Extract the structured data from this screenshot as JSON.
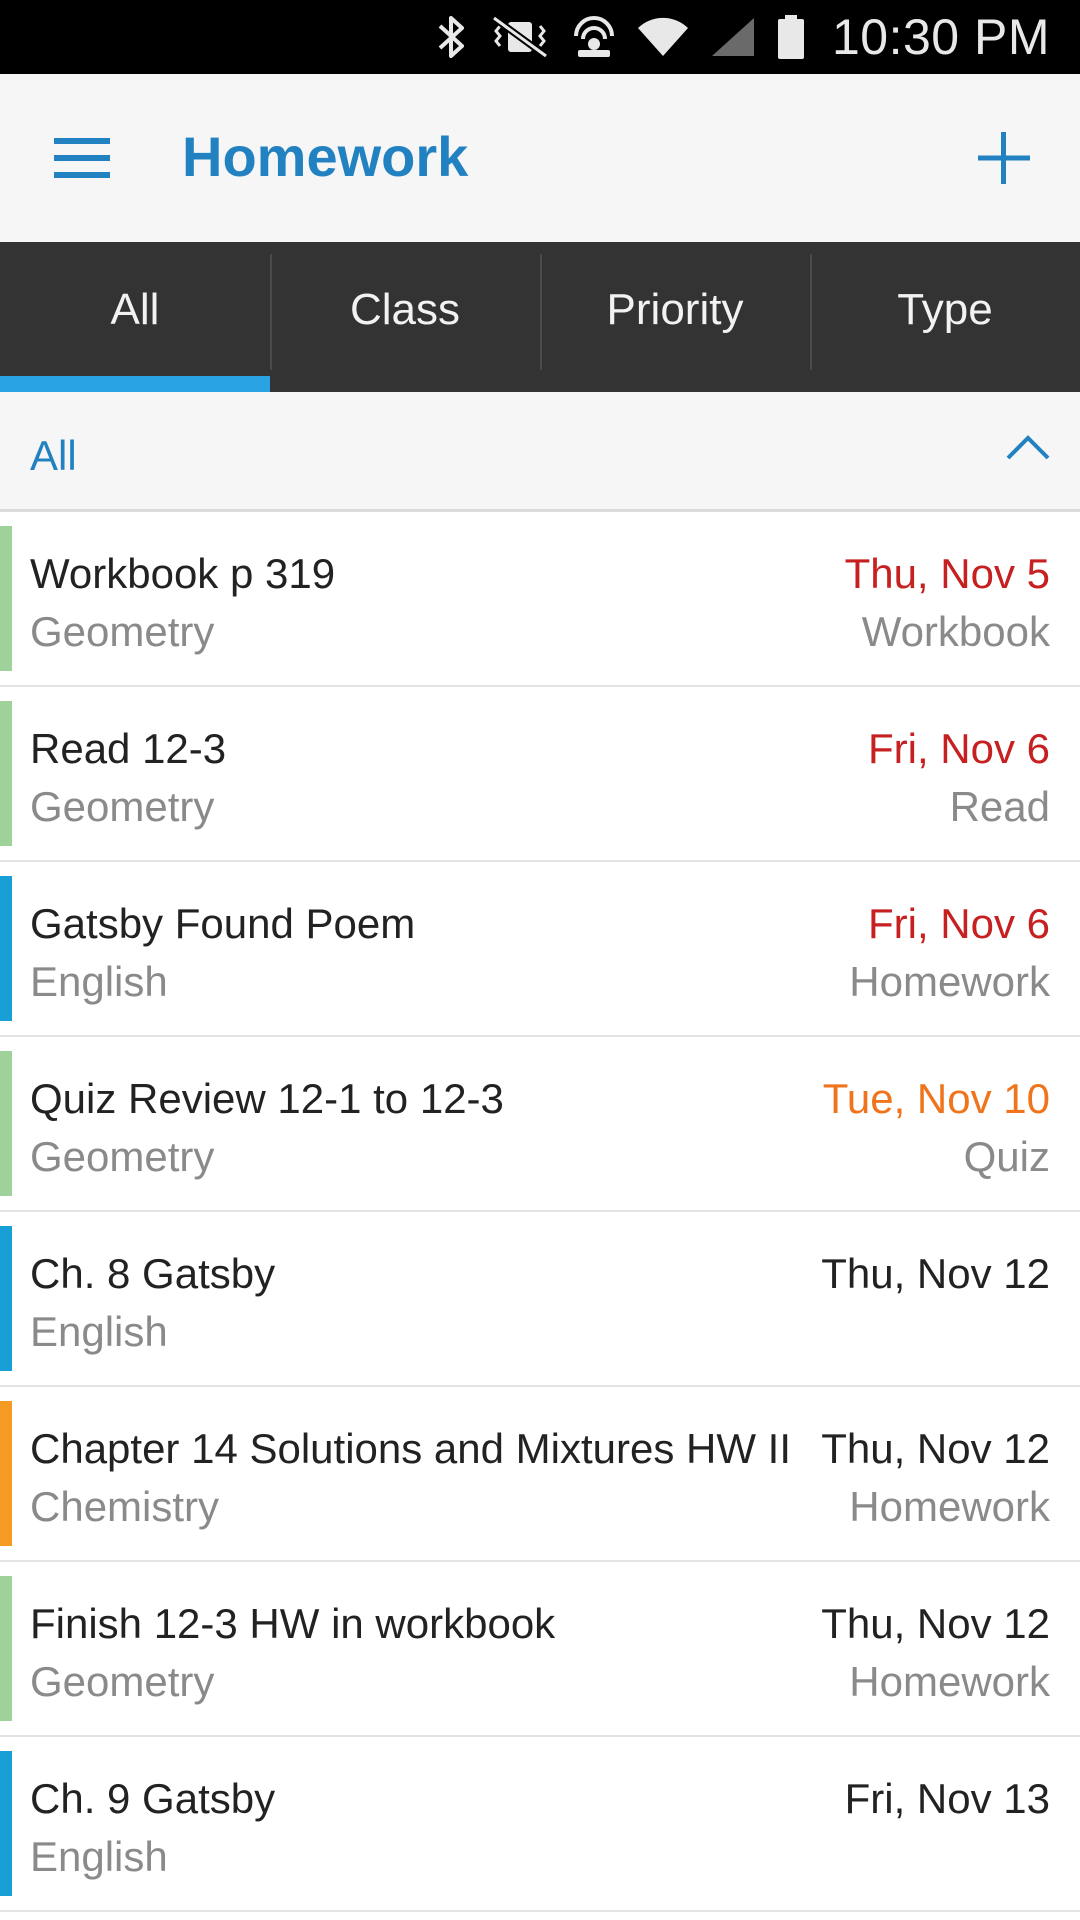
{
  "status_bar": {
    "time": "10:30 PM",
    "icons": [
      "bluetooth-icon",
      "vibrate-mute-icon",
      "hotspot-icon",
      "wifi-icon",
      "signal-icon",
      "battery-icon"
    ]
  },
  "app_bar": {
    "title": "Homework",
    "accent_color": "#2281c0",
    "menu_icon": "hamburger-menu-icon",
    "add_icon": "plus-icon"
  },
  "tabs": [
    {
      "label": "All",
      "active": true
    },
    {
      "label": "Class",
      "active": false
    },
    {
      "label": "Priority",
      "active": false
    },
    {
      "label": "Type",
      "active": false
    }
  ],
  "filter": {
    "label": "All",
    "icon": "chevron-up-icon"
  },
  "colors": {
    "geometry": "#9fd29a",
    "english": "#189fd6",
    "chemistry": "#f59a23",
    "date_overdue": "#c62020",
    "date_soon": "#f0741d",
    "date_normal": "#222222",
    "tab_indicator": "#29a3e3"
  },
  "homework": [
    {
      "title": "Workbook p 319",
      "class": "Geometry",
      "date": "Thu, Nov 5",
      "type": "Workbook",
      "class_color": "#9fd29a",
      "date_color": "#c62020"
    },
    {
      "title": "Read 12-3",
      "class": "Geometry",
      "date": "Fri, Nov 6",
      "type": "Read",
      "class_color": "#9fd29a",
      "date_color": "#c62020"
    },
    {
      "title": "Gatsby Found Poem",
      "class": "English",
      "date": "Fri, Nov 6",
      "type": "Homework",
      "class_color": "#189fd6",
      "date_color": "#c62020"
    },
    {
      "title": "Quiz Review 12-1 to 12-3",
      "class": "Geometry",
      "date": "Tue, Nov 10",
      "type": "Quiz",
      "class_color": "#9fd29a",
      "date_color": "#f0741d"
    },
    {
      "title": "Ch. 8 Gatsby",
      "class": "English",
      "date": "Thu, Nov 12",
      "type": "",
      "class_color": "#189fd6",
      "date_color": "#222222"
    },
    {
      "title": "Chapter 14 Solutions and Mixtures HW II",
      "class": "Chemistry",
      "date": "Thu, Nov 12",
      "type": "Homework",
      "class_color": "#f59a23",
      "date_color": "#222222"
    },
    {
      "title": "Finish 12-3 HW in workbook",
      "class": "Geometry",
      "date": "Thu, Nov 12",
      "type": "Homework",
      "class_color": "#9fd29a",
      "date_color": "#222222"
    },
    {
      "title": "Ch. 9 Gatsby",
      "class": "English",
      "date": "Fri, Nov 13",
      "type": "",
      "class_color": "#189fd6",
      "date_color": "#222222"
    }
  ]
}
